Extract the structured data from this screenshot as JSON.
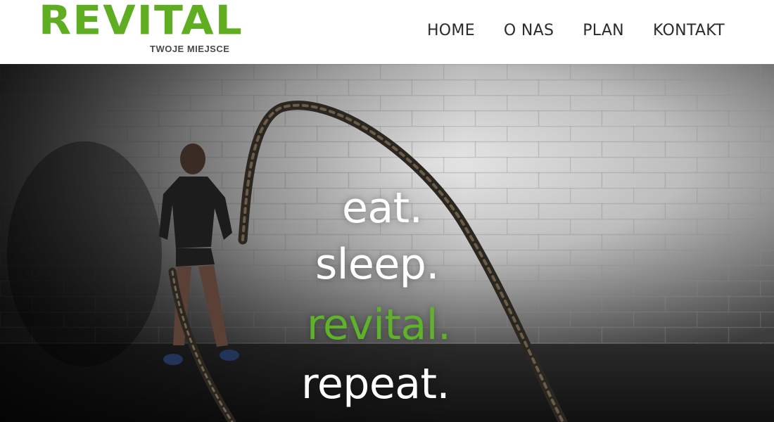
{
  "brand": {
    "name": "REVITAL",
    "tagline": "TWOJE MIEJSCE",
    "accent_color": "#5fae21"
  },
  "nav": {
    "items": [
      {
        "label": "HOME"
      },
      {
        "label": "O NAS"
      },
      {
        "label": "PLAN"
      },
      {
        "label": "KONTAKT"
      }
    ]
  },
  "hero": {
    "lines": [
      "eat.",
      "sleep.",
      "revital.",
      "repeat."
    ],
    "highlight_color": "#5fb32a"
  }
}
